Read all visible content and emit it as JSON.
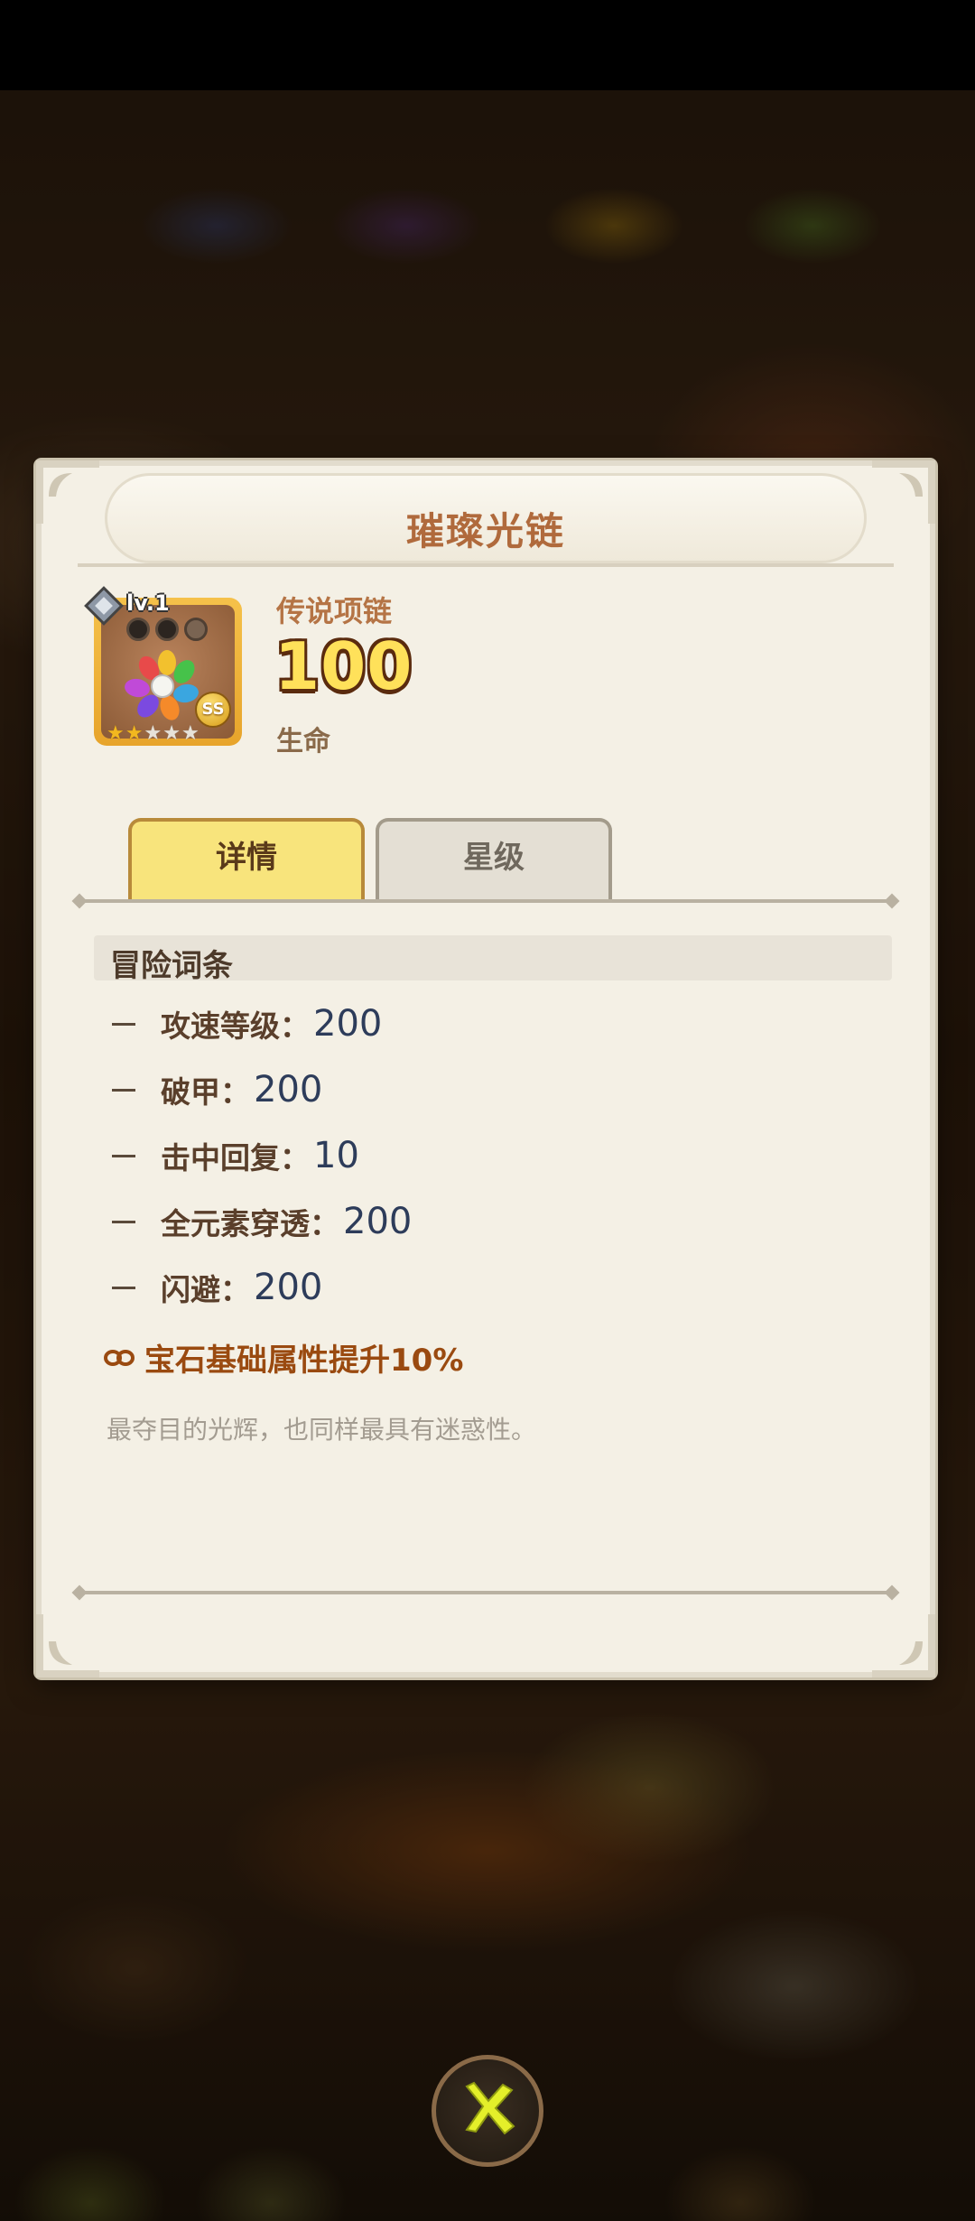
{
  "item": {
    "name": "璀璨光链",
    "type": "传说项链",
    "value": "100",
    "stat": "生命",
    "level": "lv.1",
    "grade": "SS",
    "stars_filled": 2,
    "stars_total": 5
  },
  "tabs": [
    {
      "label": "详情",
      "active": true
    },
    {
      "label": "星级",
      "active": false
    }
  ],
  "section": {
    "title": "冒险词条"
  },
  "affixes": [
    {
      "label": "攻速等级：",
      "value": "200"
    },
    {
      "label": "破甲：",
      "value": "200"
    },
    {
      "label": "击中回复：",
      "value": "10"
    },
    {
      "label": "全元素穿透：",
      "value": "200"
    },
    {
      "label": "闪避：",
      "value": "200"
    }
  ],
  "set_bonus": {
    "label": "宝石基础属性提升10%",
    "icon": "link-icon"
  },
  "flavor": "最夺目的光辉，也同样最具有迷惑性。",
  "colors": {
    "title": "#b06a3c",
    "tab_active": "#f8e47c",
    "tab_inactive": "#e4dfd4",
    "set_bonus": "#9a4a10",
    "affix_value": "#2d3c5a"
  },
  "close_button": {
    "icon": "close-x-icon"
  }
}
